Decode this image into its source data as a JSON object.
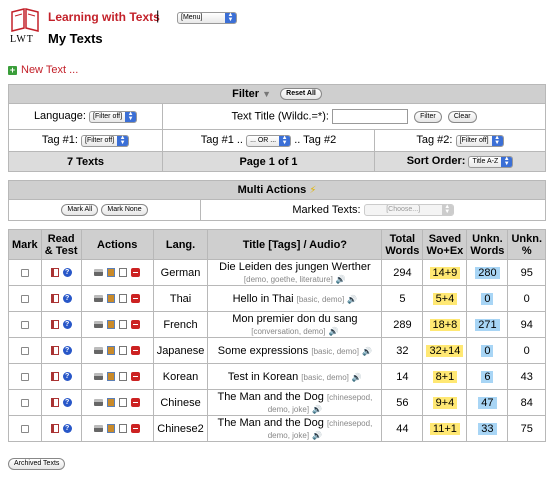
{
  "header": {
    "logo_text": "LWT",
    "app_title": "Learning with Texts",
    "separator": "|",
    "menu_select": "[Menu]",
    "page_title": "My Texts"
  },
  "new_text": "New Text ...",
  "filter": {
    "title": "Filter",
    "reset_all": "Reset All",
    "language_label": "Language:",
    "language_value": "[Filter off]",
    "title_label": "Text Title (Wildc.=*):",
    "title_input": "",
    "filter_btn": "Filter",
    "clear_btn": "Clear",
    "tag1_label": "Tag #1:",
    "tag1_value": "[Filter off]",
    "tag_mid_prefix": "Tag #1 ..",
    "tag_op": "... OR ...",
    "tag_mid_suffix": ".. Tag #2",
    "tag2_label": "Tag #2:",
    "tag2_value": "[Filter off]",
    "texts_count": "7 Texts",
    "page_info": "Page 1 of 1",
    "sort_label": "Sort Order:",
    "sort_value": "Title A-Z"
  },
  "multi": {
    "title": "Multi Actions",
    "mark_all": "Mark All",
    "mark_none": "Mark None",
    "marked_label": "Marked Texts:",
    "marked_value": "[Choose...]"
  },
  "table": {
    "headers": {
      "mark": "Mark",
      "read1": "Read",
      "read2": "& Test",
      "actions": "Actions",
      "lang": "Lang.",
      "title": "Title [Tags] / Audio?",
      "total1": "Total",
      "total2": "Words",
      "saved1": "Saved",
      "saved2": "Wo+Ex",
      "unkn1": "Unkn.",
      "unkn2": "Words",
      "unknp1": "Unkn.",
      "unknp2": "%"
    },
    "rows": [
      {
        "lang": "German",
        "title": "Die Leiden des jungen Werther",
        "tags": "[demo, goethe, literature]",
        "total": "294",
        "saved": "14+9",
        "unkn": "280",
        "pct": "95"
      },
      {
        "lang": "Thai",
        "title": "Hello in Thai",
        "tags": "[basic, demo]",
        "total": "5",
        "saved": "5+4",
        "unkn": "0",
        "pct": "0"
      },
      {
        "lang": "French",
        "title": "Mon premier don du sang",
        "tags": "[conversation, demo]",
        "total": "289",
        "saved": "18+8",
        "unkn": "271",
        "pct": "94"
      },
      {
        "lang": "Japanese",
        "title": "Some expressions",
        "tags": "[basic, demo]",
        "total": "32",
        "saved": "32+14",
        "unkn": "0",
        "pct": "0"
      },
      {
        "lang": "Korean",
        "title": "Test in Korean",
        "tags": "[basic, demo]",
        "total": "14",
        "saved": "8+1",
        "unkn": "6",
        "pct": "43"
      },
      {
        "lang": "Chinese",
        "title": "The Man and the Dog",
        "tags": "[chinesepod, demo, joke]",
        "total": "56",
        "saved": "9+4",
        "unkn": "47",
        "pct": "84"
      },
      {
        "lang": "Chinese2",
        "title": "The Man and the Dog",
        "tags": "[chinesepod, demo, joke]",
        "total": "44",
        "saved": "11+1",
        "unkn": "33",
        "pct": "75"
      }
    ]
  },
  "archived_btn": "Archived Texts",
  "colors": {
    "accent": "#c3212a",
    "saved_bg": "#ffe873",
    "unkn_bg": "#a8d5f5"
  }
}
